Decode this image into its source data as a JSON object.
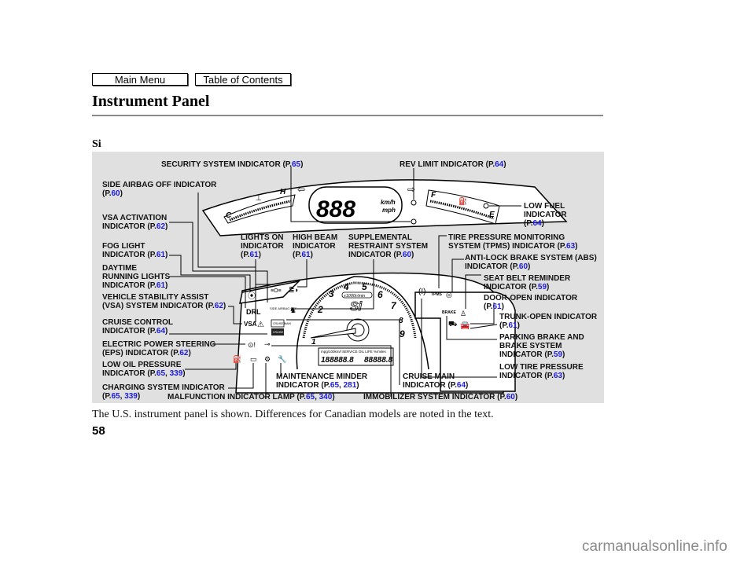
{
  "nav": {
    "main_menu": "Main Menu",
    "table_of_contents": "Table of Contents"
  },
  "header": {
    "title": "Instrument Panel",
    "subtitle": "Si"
  },
  "diagram": {
    "labels": [
      {
        "id": "security",
        "lines": [
          "SECURITY SYSTEM INDICATOR (P.{65})"
        ]
      },
      {
        "id": "rev-limit",
        "lines": [
          "REV LIMIT INDICATOR (P.{64})"
        ]
      },
      {
        "id": "side-airbag-off",
        "lines": [
          "SIDE AIRBAG OFF INDICATOR",
          "(P.{60})"
        ]
      },
      {
        "id": "low-fuel",
        "lines": [
          "LOW FUEL",
          "INDICATOR",
          "(P.{64})"
        ]
      },
      {
        "id": "vsa-activation",
        "lines": [
          "VSA ACTIVATION",
          "INDICATOR (P.{62})"
        ]
      },
      {
        "id": "lights-on",
        "lines": [
          "LIGHTS ON",
          "INDICATOR",
          "(P.{61})"
        ]
      },
      {
        "id": "high-beam",
        "lines": [
          "HIGH BEAM",
          "INDICATOR",
          "(P.{61})"
        ]
      },
      {
        "id": "srs",
        "lines": [
          "SUPPLEMENTAL",
          "RESTRAINT SYSTEM",
          "INDICATOR (P.{60})"
        ]
      },
      {
        "id": "tpms",
        "lines": [
          "TIRE PRESSURE MONITORING",
          "SYSTEM (TPMS) INDICATOR (P.{63})"
        ]
      },
      {
        "id": "fog-light",
        "lines": [
          "FOG LIGHT",
          "INDICATOR (P.{61})"
        ]
      },
      {
        "id": "abs",
        "lines": [
          "ANTI-LOCK BRAKE SYSTEM (ABS)",
          "INDICATOR (P.{60})"
        ]
      },
      {
        "id": "drl",
        "lines": [
          "DAYTIME",
          "RUNNING LIGHTS",
          "INDICATOR (P.{61})"
        ]
      },
      {
        "id": "seat-belt",
        "lines": [
          "SEAT BELT REMINDER",
          "INDICATOR (P.{59})"
        ]
      },
      {
        "id": "vsa-system",
        "lines": [
          "VEHICLE STABILITY ASSIST",
          "(VSA) SYSTEM INDICATOR (P.{62})"
        ]
      },
      {
        "id": "door-open",
        "lines": [
          "DOOR-OPEN INDICATOR",
          "(P.{61})"
        ]
      },
      {
        "id": "cruise-control",
        "lines": [
          "CRUISE CONTROL",
          "INDICATOR (P.{64})"
        ]
      },
      {
        "id": "trunk-open",
        "lines": [
          "TRUNK-OPEN INDICATOR",
          "(P.{61})"
        ]
      },
      {
        "id": "eps",
        "lines": [
          "ELECTRIC POWER STEERING",
          "(EPS) INDICATOR (P.{62})"
        ]
      },
      {
        "id": "parking-brake",
        "lines": [
          "PARKING BRAKE AND",
          "BRAKE SYSTEM",
          "INDICATOR (P.{59})"
        ]
      },
      {
        "id": "low-oil",
        "lines": [
          "LOW OIL PRESSURE",
          "INDICATOR (P.{65}, {339})"
        ]
      },
      {
        "id": "low-tire",
        "lines": [
          "LOW TIRE PRESSURE",
          "INDICATOR (P.{63})"
        ]
      },
      {
        "id": "maintenance",
        "lines": [
          "MAINTENANCE MINDER",
          "INDICATOR (P.{65}, {281})"
        ]
      },
      {
        "id": "cruise-main",
        "lines": [
          "CRUISE MAIN",
          "INDICATOR (P.{64})"
        ]
      },
      {
        "id": "charging",
        "lines": [
          "CHARGING SYSTEM INDICATOR",
          "(P.{65}, {339})"
        ]
      },
      {
        "id": "mil",
        "lines": [
          "MALFUNCTION INDICATOR LAMP (P.{65}, {340})"
        ]
      },
      {
        "id": "immobilizer",
        "lines": [
          "IMMOBILIZER SYSTEM INDICATOR (P.{60})"
        ]
      }
    ],
    "gauge_text": {
      "speed_digits": "888",
      "speed_unit_top": "km/h",
      "speed_unit_bottom": "mph",
      "temp_h": "H",
      "temp_c": "C",
      "fuel_f": "F",
      "fuel_e": "E",
      "tach_numbers": [
        "1",
        "2",
        "3",
        "4",
        "5",
        "6",
        "7",
        "8",
        "9"
      ],
      "tach_unit": "x1000r/min",
      "model_badge": "Si",
      "drl": "DRL",
      "vsa": "VSA",
      "tpms": "TPMS",
      "brake": "BRAKE",
      "cruise_main": "CRUISE MAIN",
      "cruise_control": "CRUISE CONTROL",
      "side_airbag_off": "SIDE AIRBAG OFF",
      "odometer_header": "mpg/100km/l SERVICE OIL LIFE %/miles",
      "odometer_digits": "188888.8",
      "trip_digits": "88888.8"
    }
  },
  "caption": "The U.S. instrument panel is shown. Differences for Canadian models are noted in the text.",
  "page_number": "58",
  "watermark": "carmanualsonline.info",
  "colors": {
    "page_ref": "#1a1adc",
    "panel_bg": "#e0e0e0"
  }
}
